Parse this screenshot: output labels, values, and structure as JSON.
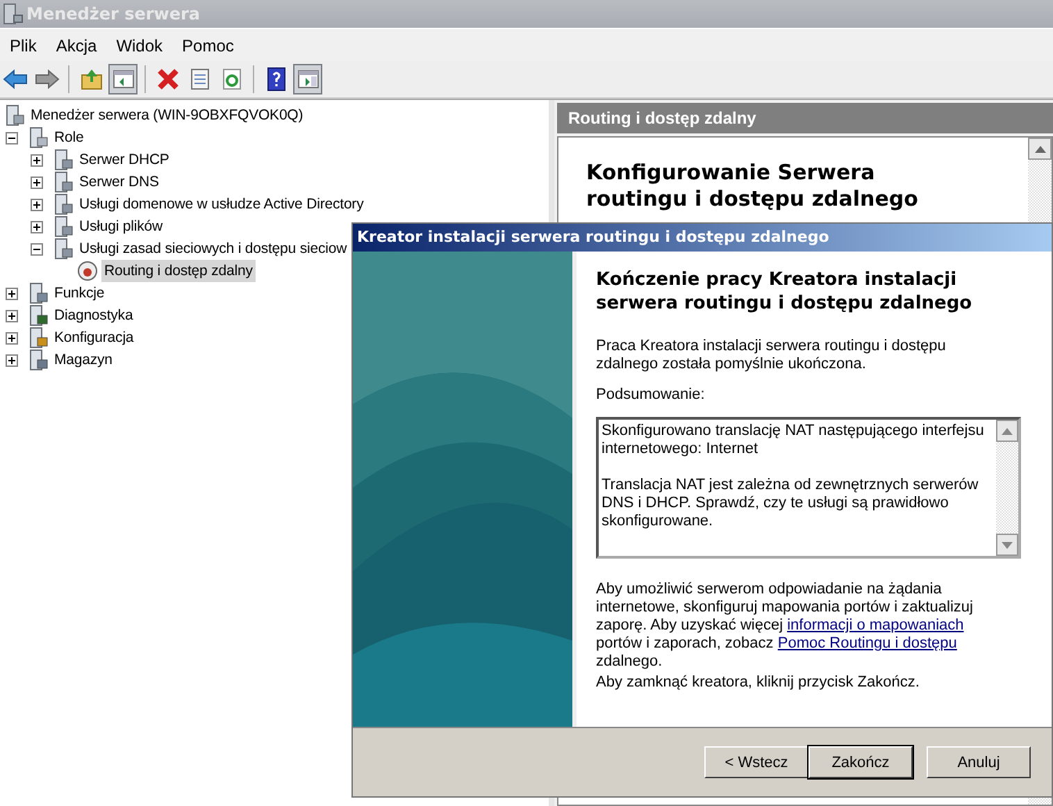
{
  "window": {
    "title": "Menedżer serwera"
  },
  "menu": [
    "Plik",
    "Akcja",
    "Widok",
    "Pomoc"
  ],
  "toolbar": [
    {
      "kind": "back",
      "pressed": false
    },
    {
      "kind": "forward",
      "pressed": false
    },
    {
      "kind": "sep"
    },
    {
      "kind": "up",
      "pressed": false
    },
    {
      "kind": "tree",
      "pressed": true
    },
    {
      "kind": "sep"
    },
    {
      "kind": "delete",
      "pressed": false
    },
    {
      "kind": "props",
      "pressed": false
    },
    {
      "kind": "refresh",
      "pressed": false
    },
    {
      "kind": "sep"
    },
    {
      "kind": "help",
      "pressed": false
    },
    {
      "kind": "actions",
      "pressed": true
    }
  ],
  "tree": {
    "label": "Menedżer serwera (WIN-9OBXFQVOK0Q)",
    "kind": "server",
    "selected": false,
    "children": [
      {
        "label": "Role",
        "kind": "roles",
        "expanded": true,
        "selected": false,
        "children": [
          {
            "label": "Serwer DHCP",
            "kind": "role",
            "expanded": false,
            "selected": false
          },
          {
            "label": "Serwer DNS",
            "kind": "role",
            "expanded": false,
            "selected": false
          },
          {
            "label": "Usługi domenowe w usłudze Active Directory",
            "kind": "role",
            "expanded": false,
            "selected": false
          },
          {
            "label": "Usługi plików",
            "kind": "role",
            "expanded": false,
            "selected": false
          },
          {
            "label": "Usługi zasad sieciowych i dostępu sieciow",
            "kind": "role",
            "expanded": true,
            "selected": false,
            "children": [
              {
                "label": "Routing i dostęp zdalny",
                "kind": "routing",
                "selected": true
              }
            ]
          }
        ]
      },
      {
        "label": "Funkcje",
        "kind": "features",
        "expanded": false,
        "selected": false
      },
      {
        "label": "Diagnostyka",
        "kind": "diag",
        "expanded": false,
        "selected": false
      },
      {
        "label": "Konfiguracja",
        "kind": "config",
        "expanded": false,
        "selected": false
      },
      {
        "label": "Magazyn",
        "kind": "storage",
        "expanded": false,
        "selected": false
      }
    ]
  },
  "right_pane": {
    "header": "Routing i dostęp zdalny",
    "heading": "Konfigurowanie Serwera routingu i dostępu zdalnego"
  },
  "dialog": {
    "title": "Kreator instalacji serwera routingu i dostępu zdalnego",
    "heading": "Kończenie pracy Kreatora instalacji serwera routingu i dostępu zdalnego",
    "intro": "Praca Kreatora instalacji serwera routingu i dostępu zdalnego została pomyślnie ukończona.",
    "summary_label": "Podsumowanie:",
    "summary": [
      "Skonfigurowano translację NAT następującego interfejsu internetowego: Internet",
      "Translacja NAT jest zależna od zewnętrznych serwerów DNS i DHCP. Sprawdź, czy te usługi są prawidłowo skonfigurowane."
    ],
    "note": [
      {
        "text": "Aby umożliwić serwerom odpowiadanie na żądania internetowe, skonfiguruj mapowania portów i zaktualizuj zaporę. Aby uzyskać więcej ",
        "link": false
      },
      {
        "text": "informacji o mapowaniach",
        "link": true
      },
      {
        "text": " portów i  zaporach, zobacz ",
        "link": false
      },
      {
        "text": "Pomoc Routingu i dostępu",
        "link": true
      },
      {
        "text": " zdalnego.",
        "link": false
      }
    ],
    "close_hint": "Aby zamknąć kreatora, kliknij przycisk Zakończ.",
    "buttons": [
      {
        "label": "< Wstecz",
        "default": false
      },
      {
        "label": "Zakończ",
        "default": true
      },
      {
        "label": "Anuluj",
        "default": false
      }
    ]
  }
}
